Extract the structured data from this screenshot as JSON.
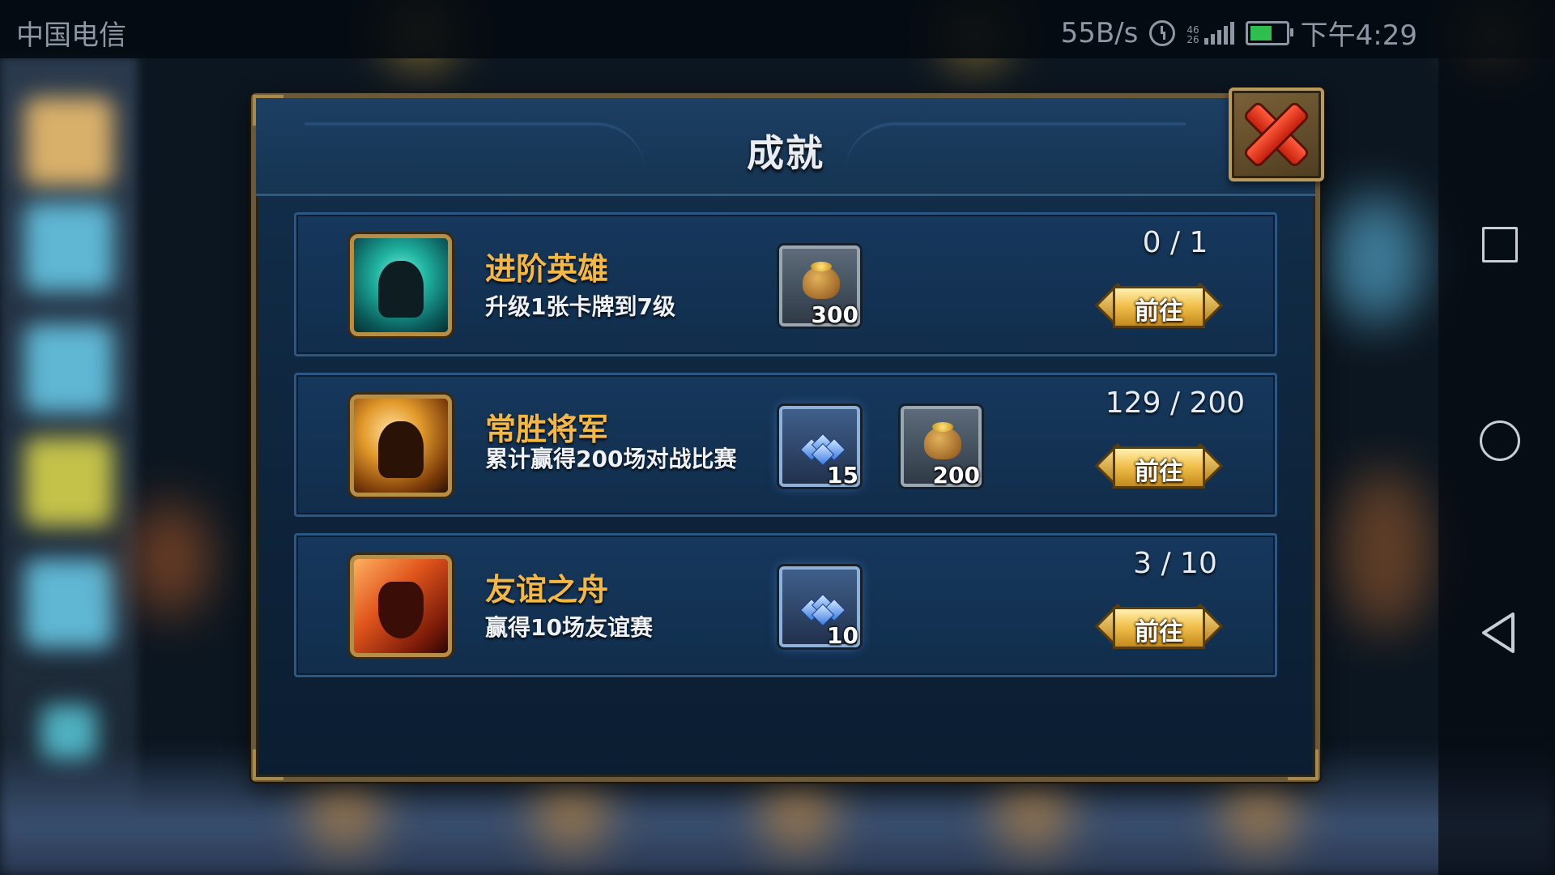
{
  "status_bar": {
    "carrier": "中国电信",
    "net_speed": "55B/s",
    "network_label_top": "46",
    "network_label_bottom": "26",
    "time": "下午4:29",
    "battery_color": "#2fbf4e"
  },
  "dialog": {
    "title": "成就",
    "close_icon": "close-x-icon"
  },
  "achievements": [
    {
      "name": "进阶英雄",
      "description": "升级1张卡牌到7级",
      "progress": "0 / 1",
      "button_label": "前往",
      "icon": "hero-upgrade-icon",
      "rewards": [
        {
          "type": "gold",
          "icon": "gold-bag-icon",
          "qty": "300"
        }
      ]
    },
    {
      "name": "常胜将军",
      "description": "累计赢得200场对战比赛",
      "progress": "129 / 200",
      "button_label": "前往",
      "icon": "victory-general-icon",
      "rewards": [
        {
          "type": "gem",
          "icon": "gem-pile-icon",
          "qty": "15"
        },
        {
          "type": "gold",
          "icon": "gold-bag-icon",
          "qty": "200"
        }
      ]
    },
    {
      "name": "友谊之舟",
      "description": "赢得10场友谊赛",
      "progress": "3 / 10",
      "button_label": "前往",
      "icon": "friendship-ship-icon",
      "rewards": [
        {
          "type": "gem",
          "icon": "gem-pile-icon",
          "qty": "10"
        }
      ]
    }
  ],
  "colors": {
    "title_gold": "#f3b744",
    "panel_blue": "#13304e",
    "frame_gold": "#b78e45"
  }
}
